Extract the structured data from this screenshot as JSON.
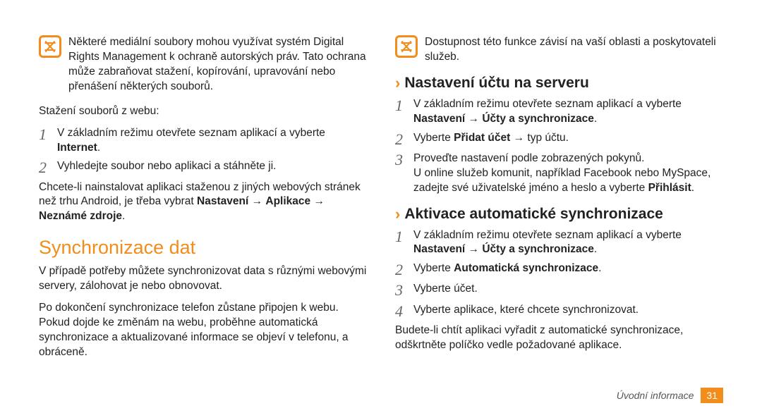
{
  "left": {
    "note": "Některé mediální soubory mohou využívat systém Digital Rights Management k ochraně autorských práv. Tato ochrana může zabraňovat stažení, kopírování, upravování nebo přenášení některých souborů.",
    "p1": "Stažení souborů z webu:",
    "step1_a": "V základním režimu otevřete seznam aplikací a vyberte ",
    "step1_b": "Internet",
    "step1_c": ".",
    "step2": "Vyhledejte soubor nebo aplikaci a stáhněte ji.",
    "p2_a": "Chcete-li nainstalovat aplikaci staženou z jiných webových stránek než trhu Android, je třeba vybrat ",
    "p2_b": "Nastavení",
    "p2_arrow1": " → ",
    "p2_c": "Aplikace",
    "p2_arrow2": " → ",
    "p2_d": "Neznámé zdroje",
    "p2_e": ".",
    "h1": "Synchronizace dat",
    "p3": "V případě potřeby můžete synchronizovat data s různými webovými servery, zálohovat je nebo obnovovat.",
    "p4": "Po dokončení synchronizace telefon zůstane připojen k webu. Pokud dojde ke změnám na webu, proběhne automatická synchronizace a aktualizované informace se objeví v telefonu, a obráceně."
  },
  "right": {
    "note": "Dostupnost této funkce závisí na vaší oblasti a poskytovateli služeb.",
    "h2a": "Nastavení účtu na serveru",
    "a_step1_a": "V základním režimu otevřete seznam aplikací a vyberte ",
    "a_step1_b": "Nastavení",
    "a_step1_arrow": " → ",
    "a_step1_c": "Účty a synchronizace",
    "a_step1_d": ".",
    "a_step2_a": "Vyberte ",
    "a_step2_b": "Přidat účet",
    "a_step2_arrow": " → ",
    "a_step2_c": "typ účtu.",
    "a_step3": "Proveďte nastavení podle zobrazených pokynů.",
    "a_step3_note_a": "U online služeb komunit, například Facebook nebo MySpace, zadejte své uživatelské jméno a heslo a vyberte ",
    "a_step3_note_b": "Přihlásit",
    "a_step3_note_c": ".",
    "h2b": "Aktivace automatické synchronizace",
    "b_step1_a": "V základním režimu otevřete seznam aplikací a vyberte ",
    "b_step1_b": "Nastavení",
    "b_step1_arrow": " → ",
    "b_step1_c": "Účty a synchronizace",
    "b_step1_d": ".",
    "b_step2_a": "Vyberte ",
    "b_step2_b": "Automatická synchronizace",
    "b_step2_c": ".",
    "b_step3": "Vyberte účet.",
    "b_step4": "Vyberte aplikace, které chcete synchronizovat.",
    "b_p": "Budete-li chtít aplikaci vyřadit z automatické synchronizace, odškrtněte políčko vedle požadované aplikace."
  },
  "footer": {
    "section": "Úvodní informace",
    "page": "31"
  },
  "nums": {
    "n1": "1",
    "n2": "2",
    "n3": "3",
    "n4": "4"
  }
}
